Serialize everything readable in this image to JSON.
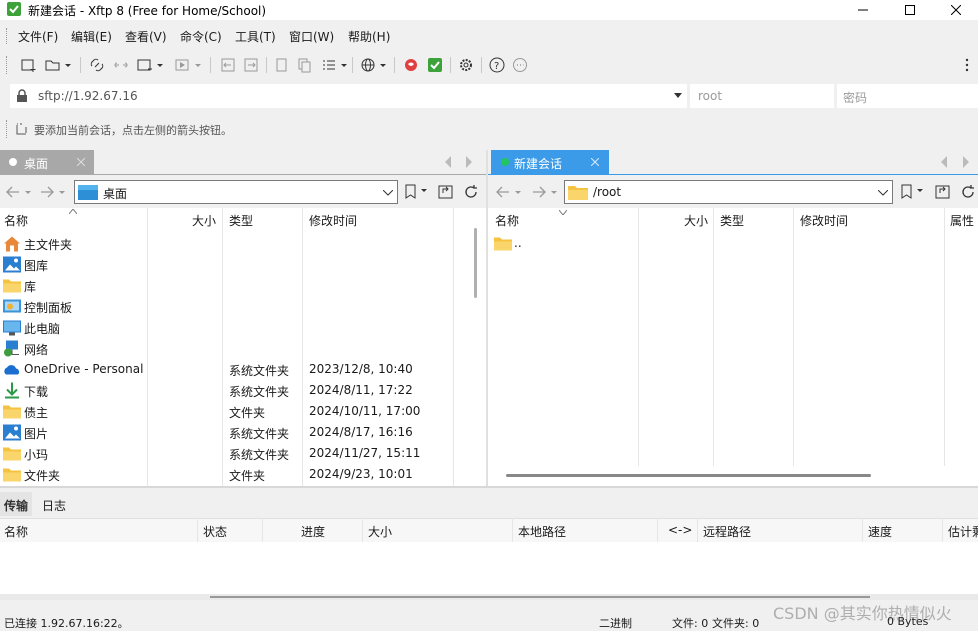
{
  "window": {
    "title": "新建会话 - Xftp 8 (Free for Home/School)"
  },
  "menu": [
    "文件(F)",
    "编辑(E)",
    "查看(V)",
    "命令(C)",
    "工具(T)",
    "窗口(W)",
    "帮助(H)"
  ],
  "address": {
    "url": "sftp://1.92.67.16",
    "user_placeholder": "root",
    "password_placeholder": "密码"
  },
  "hint": "要添加当前会话，点击左侧的箭头按钮。",
  "left_pane": {
    "tab": "桌面",
    "path": "桌面",
    "columns": [
      "名称",
      "大小",
      "类型",
      "修改时间"
    ],
    "rows": [
      {
        "name": "主文件夹",
        "type": "",
        "date": "",
        "icon": "home-icon"
      },
      {
        "name": "图库",
        "type": "",
        "date": "",
        "icon": "gallery-icon"
      },
      {
        "name": "库",
        "type": "",
        "date": "",
        "icon": "folder-icon"
      },
      {
        "name": "控制面板",
        "type": "",
        "date": "",
        "icon": "control-panel-icon"
      },
      {
        "name": "此电脑",
        "type": "",
        "date": "",
        "icon": "computer-icon"
      },
      {
        "name": "网络",
        "type": "",
        "date": "",
        "icon": "network-icon"
      },
      {
        "name": "OneDrive - Personal",
        "type": "系统文件夹",
        "date": "2023/12/8, 10:40",
        "icon": "onedrive-icon"
      },
      {
        "name": "下载",
        "type": "系统文件夹",
        "date": "2024/8/11, 17:22",
        "icon": "download-icon"
      },
      {
        "name": "债主",
        "type": "文件夹",
        "date": "2024/10/11, 17:00",
        "icon": "folder-icon"
      },
      {
        "name": "图片",
        "type": "系统文件夹",
        "date": "2024/8/17, 16:16",
        "icon": "pictures-icon"
      },
      {
        "name": "小玛",
        "type": "系统文件夹",
        "date": "2024/11/27, 15:11",
        "icon": "folder-icon"
      },
      {
        "name": "文件夹",
        "type": "文件夹",
        "date": "2024/9/23, 10:01",
        "icon": "folder-icon"
      }
    ]
  },
  "right_pane": {
    "tab": "新建会话",
    "path": "/root",
    "columns": [
      "名称",
      "大小",
      "类型",
      "修改时间",
      "属性"
    ],
    "rows": [
      {
        "name": "..",
        "icon": "folder-icon"
      }
    ]
  },
  "transfer": {
    "tabs": [
      "传输",
      "日志"
    ],
    "columns": [
      "名称",
      "状态",
      "进度",
      "大小",
      "本地路径",
      "<->",
      "远程路径",
      "速度",
      "估计剩"
    ]
  },
  "status": {
    "connection": "已连接 1.92.67.16:22。",
    "mode": "二进制",
    "files": "文件: 0",
    "folders": "文件夹: 0",
    "bytes": "0 Bytes",
    "watermark": "CSDN @其实你热情似火"
  },
  "colors": {
    "accent": "#3c9be8",
    "folder": "#f5c342",
    "connected": "#22c55e"
  }
}
